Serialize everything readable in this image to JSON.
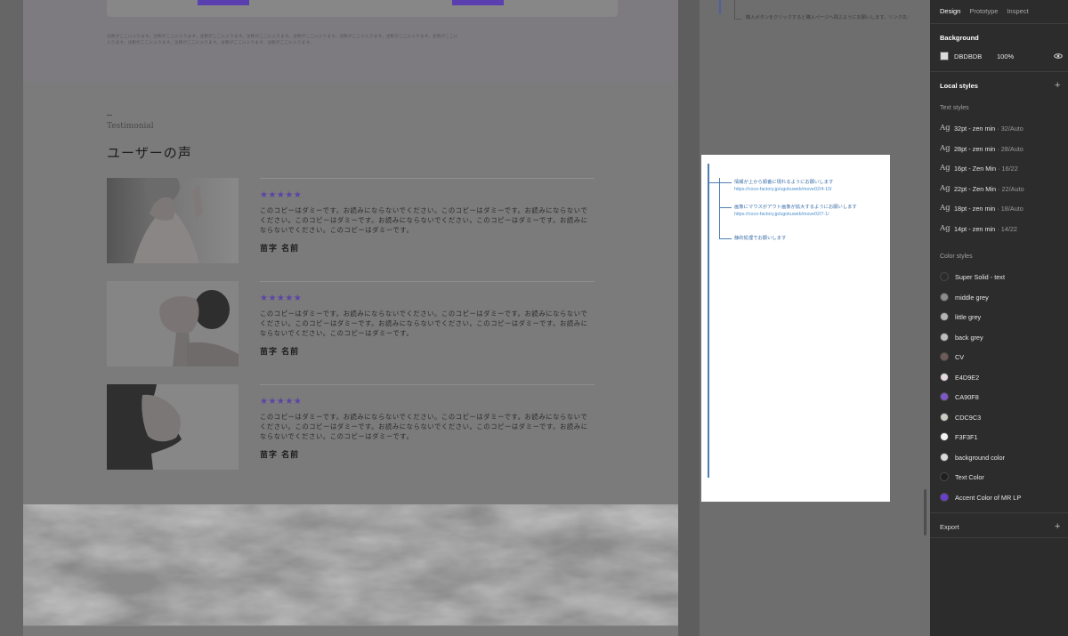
{
  "panel": {
    "tabs": [
      "Design",
      "Prototype",
      "Inspect"
    ],
    "background": {
      "label": "Background",
      "hex": "DBDBDB",
      "opacity": "100%",
      "swatch": "#dbdbdb"
    },
    "local_styles": {
      "label": "Local styles",
      "text_styles_label": "Text styles",
      "text_styles": [
        {
          "ag": "Ag",
          "name": "32pt - zen min",
          "meta": "· 32/Auto"
        },
        {
          "ag": "Ag",
          "name": "28pt - zen min",
          "meta": "· 28/Auto"
        },
        {
          "ag": "Ag",
          "name": "16pt - Zen Min",
          "meta": "· 16/22"
        },
        {
          "ag": "Ag",
          "name": "22pt - Zen Min",
          "meta": "· 22/Auto"
        },
        {
          "ag": "Ag",
          "name": "18pt - zen min",
          "meta": "· 18/Auto"
        },
        {
          "ag": "Ag",
          "name": "14pt - zen min",
          "meta": "· 14/22"
        }
      ],
      "color_styles_label": "Color styles",
      "color_styles": [
        {
          "name": "Super Solid - text",
          "color": "#2b2b2b"
        },
        {
          "name": "middle grey",
          "color": "#8c8c8c"
        },
        {
          "name": "little grey",
          "color": "#b3b3b3"
        },
        {
          "name": "back grey",
          "color": "#bdbdbd"
        },
        {
          "name": "CV",
          "color": "#6d5c56"
        },
        {
          "name": "E4D9E2",
          "color": "#e4d9e2"
        },
        {
          "name": "CA90F8",
          "color": "#7d58c8"
        },
        {
          "name": "CDC9C3",
          "color": "#cdc9c3"
        },
        {
          "name": "F3F3F1",
          "color": "#f3f3f1"
        },
        {
          "name": "background color",
          "color": "#d9d9d9"
        },
        {
          "name": "Text Color",
          "color": "#1f1f1f"
        },
        {
          "name": "Accent Color of MR LP",
          "color": "#6a3fd0"
        }
      ]
    },
    "export_label": "Export"
  },
  "canvas": {
    "dummy_text": [
      "注釈がここに入ります。注釈がここに入ります。注釈がここに入ります。注釈がここに入ります。注釈がここに入ります。注釈がここに入ります。注釈がここに入ります。注釈がここに",
      "入ります。注釈がここに入ります。注釈がここに入ります。注釈がここに入ります。注釈がここに入ります。"
    ],
    "testimonial": {
      "label": "Testimonial",
      "title": "ユーザーの声",
      "items": [
        {
          "stars": "★★★★★",
          "rating": 5,
          "body": "このコピーはダミーです。お読みにならないでください。このコピーはダミーです。お読みにならないでください。このコピーはダミーです。お読みにならないでください。このコピーはダミーです。お読みにならないでください。このコピーはダミーです。",
          "name": "苗字 名前"
        },
        {
          "stars": "★★★★★",
          "rating": 5,
          "body": "このコピーはダミーです。お読みにならないでください。このコピーはダミーです。お読みにならないでください。このコピーはダミーです。お読みにならないでください。このコピーはダミーです。お読みにならないでください。このコピーはダミーです。",
          "name": "苗字 名前"
        },
        {
          "stars": "★★★★★",
          "rating": 5,
          "body": "このコピーはダミーです。お読みにならないでください。このコピーはダミーです。お読みにならないでください。このコピーはダミーです。お読みにならないでください。このコピーはダミーです。お読みにならないでください。このコピーはダミーです。",
          "name": "苗字 名前"
        }
      ]
    },
    "annotation_top": "購入ボタンをクリックすると購入ページへ飛ぶようにお願いします。リンク先：",
    "annotations": [
      {
        "text": "情報が上から順番に現れるようにお願いします",
        "url": "https://coco-factory.jp/ugokuweb/move02/4-10/"
      },
      {
        "text": "画像にマウスがアウト画像が拡大するようにお願いします",
        "url": "https://coco-factory.jp/ugokuweb/move02/7-1/"
      },
      {
        "text": "静的処理でお願いします",
        "url": ""
      }
    ]
  }
}
